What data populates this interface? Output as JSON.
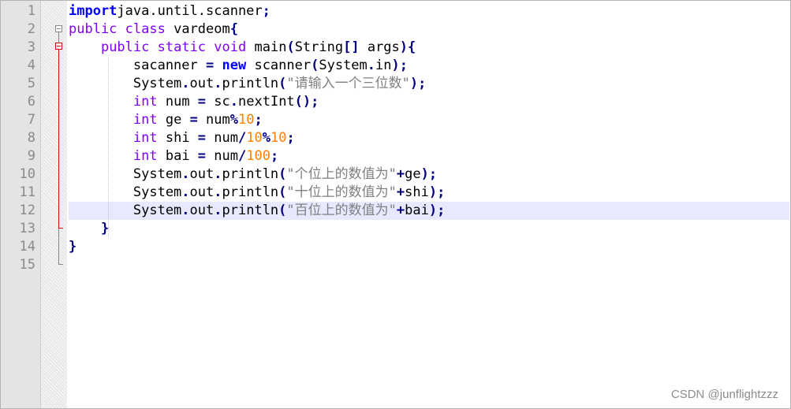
{
  "editor": {
    "line_numbers": [
      "1",
      "2",
      "3",
      "4",
      "5",
      "6",
      "7",
      "8",
      "9",
      "10",
      "11",
      "12",
      "13",
      "14",
      "15"
    ],
    "current_line": 12,
    "lines": [
      [
        [
          "kw1",
          "import"
        ],
        [
          "",
          "java.until.scanner"
        ],
        [
          "op",
          ";"
        ]
      ],
      [
        [
          "kw2",
          "public"
        ],
        [
          "",
          " "
        ],
        [
          "kw2",
          "class"
        ],
        [
          "",
          " vardeom"
        ],
        [
          "op",
          "{"
        ]
      ],
      [
        [
          "",
          "    "
        ],
        [
          "kw2",
          "public"
        ],
        [
          "",
          " "
        ],
        [
          "kw2",
          "static"
        ],
        [
          "",
          " "
        ],
        [
          "kw2",
          "void"
        ],
        [
          "",
          " main"
        ],
        [
          "op",
          "("
        ],
        [
          "",
          "String"
        ],
        [
          "op",
          "[]"
        ],
        [
          "",
          " args"
        ],
        [
          "op",
          "){"
        ]
      ],
      [
        [
          "",
          "        sacanner "
        ],
        [
          "op",
          "="
        ],
        [
          "",
          " "
        ],
        [
          "kw1",
          "new"
        ],
        [
          "",
          " scanner"
        ],
        [
          "op",
          "("
        ],
        [
          "",
          "System"
        ],
        [
          "op",
          "."
        ],
        [
          "",
          "in"
        ],
        [
          "op",
          ");"
        ]
      ],
      [
        [
          "",
          "        System"
        ],
        [
          "op",
          "."
        ],
        [
          "",
          "out"
        ],
        [
          "op",
          "."
        ],
        [
          "",
          "println"
        ],
        [
          "op",
          "("
        ],
        [
          "str",
          "\"请输入一个三位数\""
        ],
        [
          "op",
          ");"
        ]
      ],
      [
        [
          "",
          "        "
        ],
        [
          "kw2",
          "int"
        ],
        [
          "",
          " num "
        ],
        [
          "op",
          "="
        ],
        [
          "",
          " sc"
        ],
        [
          "op",
          "."
        ],
        [
          "",
          "nextInt"
        ],
        [
          "op",
          "();"
        ]
      ],
      [
        [
          "",
          "        "
        ],
        [
          "kw2",
          "int"
        ],
        [
          "",
          " ge "
        ],
        [
          "op",
          "="
        ],
        [
          "",
          " num"
        ],
        [
          "op",
          "%"
        ],
        [
          "num",
          "10"
        ],
        [
          "op",
          ";"
        ]
      ],
      [
        [
          "",
          "        "
        ],
        [
          "kw2",
          "int"
        ],
        [
          "",
          " shi "
        ],
        [
          "op",
          "="
        ],
        [
          "",
          " num"
        ],
        [
          "op",
          "/"
        ],
        [
          "num",
          "10"
        ],
        [
          "op",
          "%"
        ],
        [
          "num",
          "10"
        ],
        [
          "op",
          ";"
        ]
      ],
      [
        [
          "",
          "        "
        ],
        [
          "kw2",
          "int"
        ],
        [
          "",
          " bai "
        ],
        [
          "op",
          "="
        ],
        [
          "",
          " num"
        ],
        [
          "op",
          "/"
        ],
        [
          "num",
          "100"
        ],
        [
          "op",
          ";"
        ]
      ],
      [
        [
          "",
          "        System"
        ],
        [
          "op",
          "."
        ],
        [
          "",
          "out"
        ],
        [
          "op",
          "."
        ],
        [
          "",
          "println"
        ],
        [
          "op",
          "("
        ],
        [
          "str",
          "\"个位上的数值为\""
        ],
        [
          "op",
          "+"
        ],
        [
          "",
          "ge"
        ],
        [
          "op",
          ");"
        ]
      ],
      [
        [
          "",
          "        System"
        ],
        [
          "op",
          "."
        ],
        [
          "",
          "out"
        ],
        [
          "op",
          "."
        ],
        [
          "",
          "println"
        ],
        [
          "op",
          "("
        ],
        [
          "str",
          "\"十位上的数值为\""
        ],
        [
          "op",
          "+"
        ],
        [
          "",
          "shi"
        ],
        [
          "op",
          ");"
        ]
      ],
      [
        [
          "",
          "        System"
        ],
        [
          "op",
          "."
        ],
        [
          "",
          "out"
        ],
        [
          "op",
          "."
        ],
        [
          "",
          "println"
        ],
        [
          "op",
          "("
        ],
        [
          "str",
          "\"百位上的数值为\""
        ],
        [
          "op",
          "+"
        ],
        [
          "",
          "bai"
        ],
        [
          "op",
          ");"
        ]
      ],
      [
        [
          "",
          "    "
        ],
        [
          "op",
          "}"
        ]
      ],
      [
        [
          "op",
          "}"
        ]
      ],
      []
    ]
  },
  "watermark": "CSDN @junflightzzz"
}
